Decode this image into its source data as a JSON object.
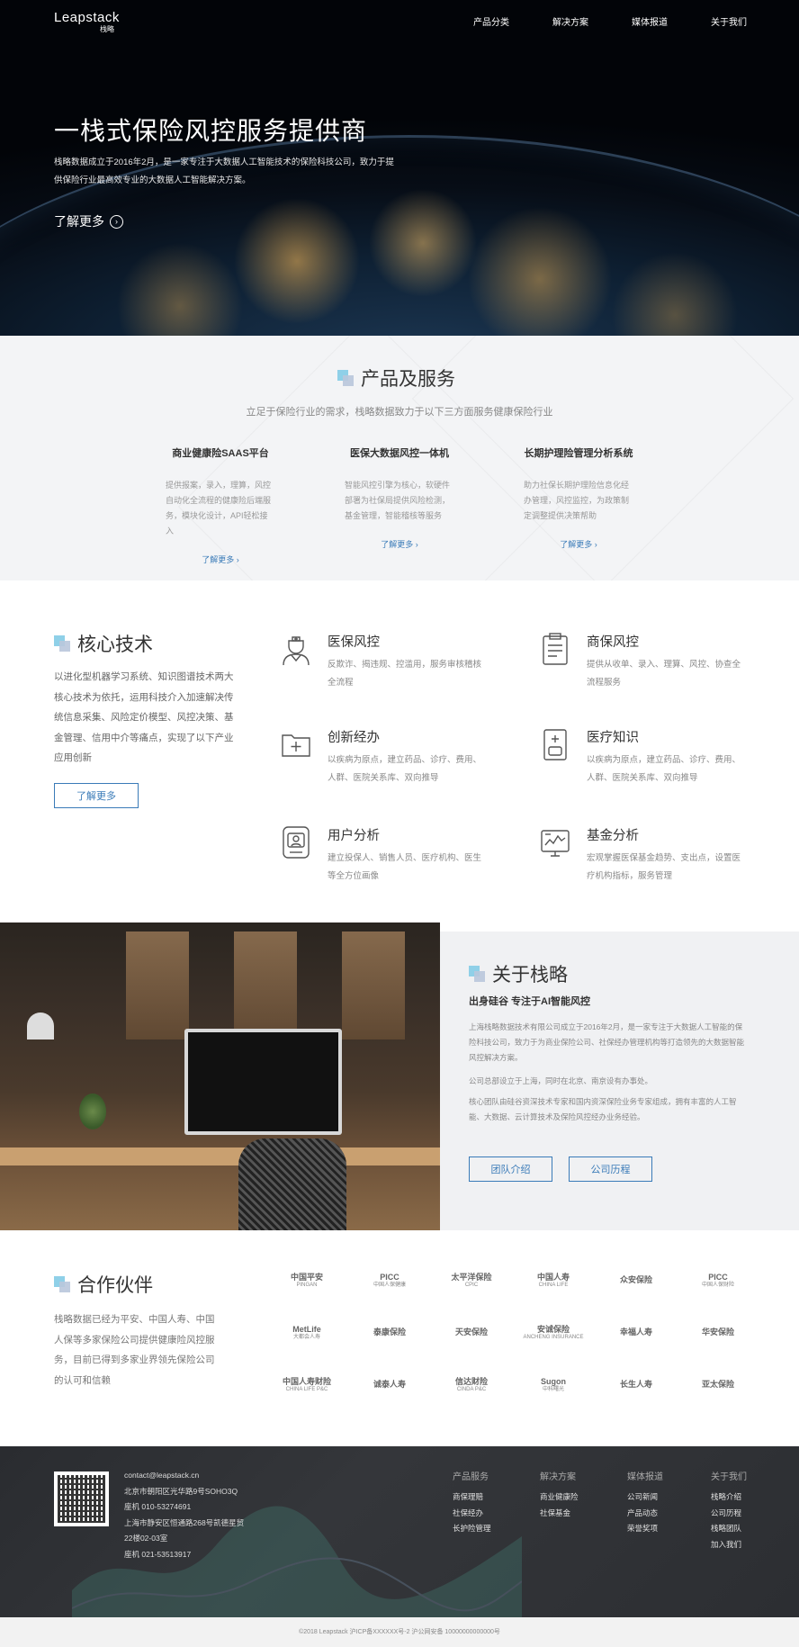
{
  "header": {
    "logo_en": "Leapstack",
    "logo_cn": "栈略",
    "nav": [
      "产品分类",
      "解决方案",
      "媒体报道",
      "关于我们"
    ]
  },
  "hero": {
    "title": "一栈式保险风控服务提供商",
    "desc": "栈略数据成立于2016年2月，是一家专注于大数据人工智能技术的保险科技公司，致力于提供保险行业最高效专业的大数据人工智能解决方案。",
    "more_label": "了解更多",
    "more_icon": "chevron-right-icon"
  },
  "products": {
    "title": "产品及服务",
    "subtitle": "立足于保险行业的需求，栈略数据致力于以下三方面服务健康保险行业",
    "items": [
      {
        "title": "商业健康险SAAS平台",
        "desc": "提供报案，录入，理算，风控自动化全流程的健康险后端服务，模块化设计，API轻松接入",
        "link": "了解更多 ›"
      },
      {
        "title": "医保大数据风控一体机",
        "desc": "智能风控引擎为核心，软硬件部署为社保局提供风险检测，基金管理，智能稽核等服务",
        "link": "了解更多 ›"
      },
      {
        "title": "长期护理险管理分析系统",
        "desc": "助力社保长期护理险信息化经办管理，风控监控，为政策制定调整提供决策帮助",
        "link": "了解更多 ›"
      }
    ]
  },
  "core": {
    "title": "核心技术",
    "desc": "以进化型机器学习系统、知识图谱技术两大核心技术为依托，运用科技介入加速解决传统信息采集、风险定价模型、风控决策、基金管理、信用中介等痛点，实现了以下产业应用创新",
    "button": "了解更多",
    "features": [
      {
        "title": "医保风控",
        "desc": "反欺诈、揭违规、控滥用，服务审核稽核全流程",
        "icon": "doctor-icon"
      },
      {
        "title": "商保风控",
        "desc": "提供从收单、录入、理算、风控、协查全流程服务",
        "icon": "clipboard-icon"
      },
      {
        "title": "创新经办",
        "desc": "以疾病为原点，建立药品、诊疗、费用、人群、医院关系库、双向推导",
        "icon": "medical-folder-icon"
      },
      {
        "title": "医疗知识",
        "desc": "以疾病为原点，建立药品、诊疗、费用、人群、医院关系库、双向推导",
        "icon": "medical-kit-icon"
      },
      {
        "title": "用户分析",
        "desc": "建立投保人、销售人员、医疗机构、医生等全方位画像",
        "icon": "user-card-icon"
      },
      {
        "title": "基金分析",
        "desc": "宏观掌握医保基金趋势、支出点，设置医疗机构指标，服务管理",
        "icon": "monitor-chart-icon"
      }
    ]
  },
  "about": {
    "title": "关于栈略",
    "subtitle": "出身硅谷 专注于AI智能风控",
    "p1": "上海栈略数据技术有限公司成立于2016年2月，是一家专注于大数据人工智能的保险科技公司，致力于为商业保险公司、社保经办管理机构等打造领先的大数据智能风控解决方案。",
    "p2": "公司总部设立于上海，同时在北京、南京设有办事处。",
    "p3": "核心团队由硅谷资深技术专家和国内资深保险业务专家组成，拥有丰富的人工智能、大数据、云计算技术及保险风控经办业务经验。",
    "btn_team": "团队介绍",
    "btn_history": "公司历程"
  },
  "partners": {
    "title": "合作伙伴",
    "desc": "栈略数据已经为平安、中国人寿、中国人保等多家保险公司提供健康险风控服务，目前已得到多家业界领先保险公司的认可和信赖",
    "logos": [
      {
        "main": "中国平安",
        "sub": "PINGAN"
      },
      {
        "main": "PICC",
        "sub": "中国人保健康"
      },
      {
        "main": "太平洋保险",
        "sub": "CPIC"
      },
      {
        "main": "中国人寿",
        "sub": "CHINA LIFE"
      },
      {
        "main": "众安保险",
        "sub": ""
      },
      {
        "main": "PICC",
        "sub": "中国人保财险"
      },
      {
        "main": "MetLife",
        "sub": "大都会人寿"
      },
      {
        "main": "泰康保险",
        "sub": ""
      },
      {
        "main": "天安保险",
        "sub": ""
      },
      {
        "main": "安诚保险",
        "sub": "ANCHENG INSURANCE"
      },
      {
        "main": "幸福人寿",
        "sub": ""
      },
      {
        "main": "华安保险",
        "sub": ""
      },
      {
        "main": "中国人寿财险",
        "sub": "CHINA LIFE P&C"
      },
      {
        "main": "诚泰人寿",
        "sub": ""
      },
      {
        "main": "信达财险",
        "sub": "CINDA P&C"
      },
      {
        "main": "Sugon",
        "sub": "中科曙光"
      },
      {
        "main": "长生人寿",
        "sub": ""
      },
      {
        "main": "亚太保险",
        "sub": ""
      }
    ]
  },
  "footer": {
    "email": "contact@leapstack.cn",
    "address1": "北京市朝阳区光华路9号SOHO3Q",
    "phone1": "座机 010-53274691",
    "address2": "上海市静安区恒通路268号凯德星贸",
    "address2b": "22楼02-03室",
    "phone2": "座机 021-53513917",
    "cols": [
      {
        "head": "产品服务",
        "items": [
          "商保理赔",
          "社保经办",
          "长护险管理"
        ]
      },
      {
        "head": "解决方案",
        "items": [
          "商业健康险",
          "社保基金"
        ]
      },
      {
        "head": "媒体报道",
        "items": [
          "公司新闻",
          "产品动态",
          "荣誉奖项"
        ]
      },
      {
        "head": "关于我们",
        "items": [
          "栈略介绍",
          "公司历程",
          "栈略团队",
          "加入我们"
        ]
      }
    ],
    "copyright": "©2018 Leapstack 沪ICP备XXXXXX号-2 沪公网安备 10000000000000号"
  }
}
